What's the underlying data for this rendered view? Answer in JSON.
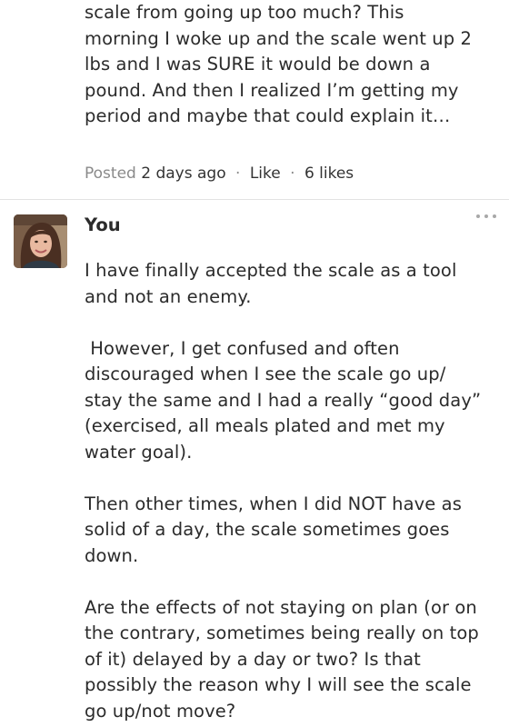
{
  "post": {
    "body_lines": [
      "scale from going up too much? This",
      "morning I woke up and the scale went up 2",
      "lbs and I was SURE it would be down a",
      "pound. And then I realized I’m getting my",
      "period and maybe that could explain it…"
    ],
    "posted_label": "Posted",
    "posted_time": "2 days ago",
    "separator": "·",
    "like_label": "Like",
    "likes_count": "6 likes"
  },
  "comment": {
    "author": "You",
    "paragraphs": [
      [
        "I have finally accepted the scale as a tool",
        "and not an enemy."
      ],
      [
        " However, I get confused and often",
        "discouraged when I see the scale go up/",
        "stay the same and I had a really “good day”",
        "(exercised, all meals plated and met my",
        "water goal)."
      ],
      [
        "Then other times, when I did NOT have as",
        "solid of a day, the scale sometimes goes",
        "down."
      ],
      [
        "Are the effects of not staying on plan (or on",
        "the contrary, sometimes being really on top",
        "of it) delayed by a day or two? Is that",
        "possibly the reason why I will see the scale",
        "go up/not move?"
      ]
    ]
  },
  "icons": {
    "more": "more-horizontal-icon",
    "avatar": "user-avatar-photo"
  }
}
